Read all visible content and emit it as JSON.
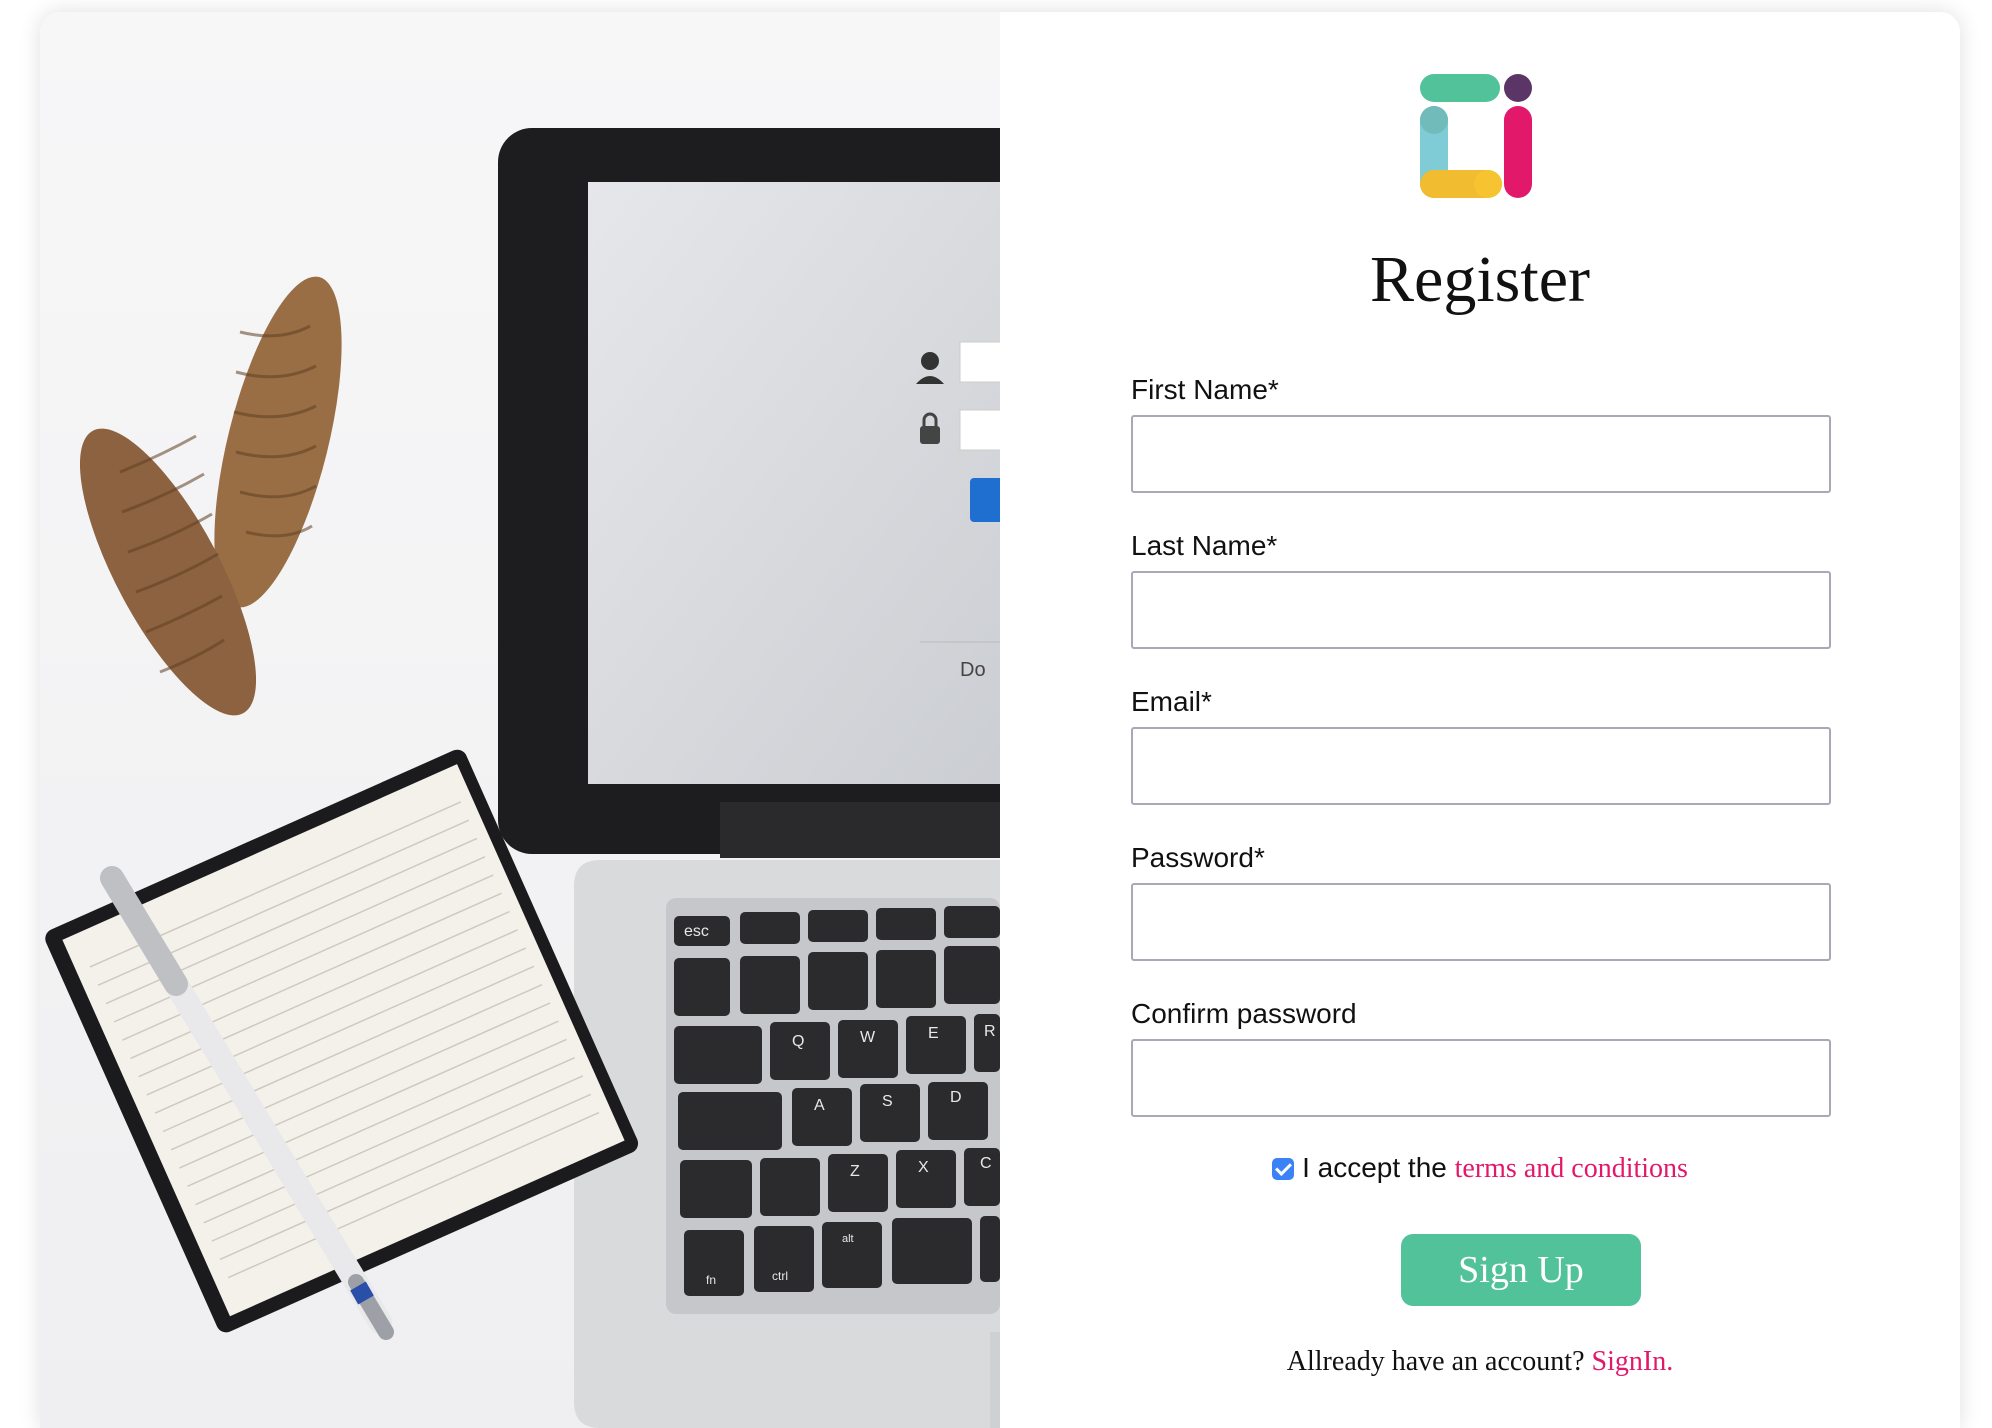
{
  "register": {
    "title": "Register",
    "fields": [
      {
        "label": "First Name*",
        "value": "",
        "placeholder": ""
      },
      {
        "label": "Last Name*",
        "value": "",
        "placeholder": ""
      },
      {
        "label": "Email*",
        "value": "",
        "placeholder": ""
      },
      {
        "label": "Password*",
        "value": "",
        "placeholder": ""
      },
      {
        "label": "Confirm password",
        "value": "",
        "placeholder": ""
      }
    ],
    "accept_text": "I accept the",
    "accept_checked": true,
    "terms_link": "terms and conditions",
    "signup_button": "Sign Up",
    "signin_prompt": "Allready have an account?",
    "signin_link": "SignIn."
  },
  "icons": {
    "logo": "brand-logo-icon",
    "checkbox": "checkbox-checked-icon"
  },
  "colors": {
    "accent_green": "#52c29a",
    "link_pink": "#e2196b",
    "checkbox_blue": "#3b82f6",
    "logo_green": "#52c29a",
    "logo_purple": "#5b3565",
    "logo_cyan": "#7fcbd6",
    "logo_yellow": "#f1bc2f",
    "logo_pink": "#e2196b"
  },
  "photo": {
    "keyboard_keys": [
      "esc",
      "Q",
      "W",
      "E",
      "R",
      "A",
      "S",
      "D",
      "Z",
      "X",
      "C",
      "fn",
      "ctrl",
      "alt"
    ]
  }
}
